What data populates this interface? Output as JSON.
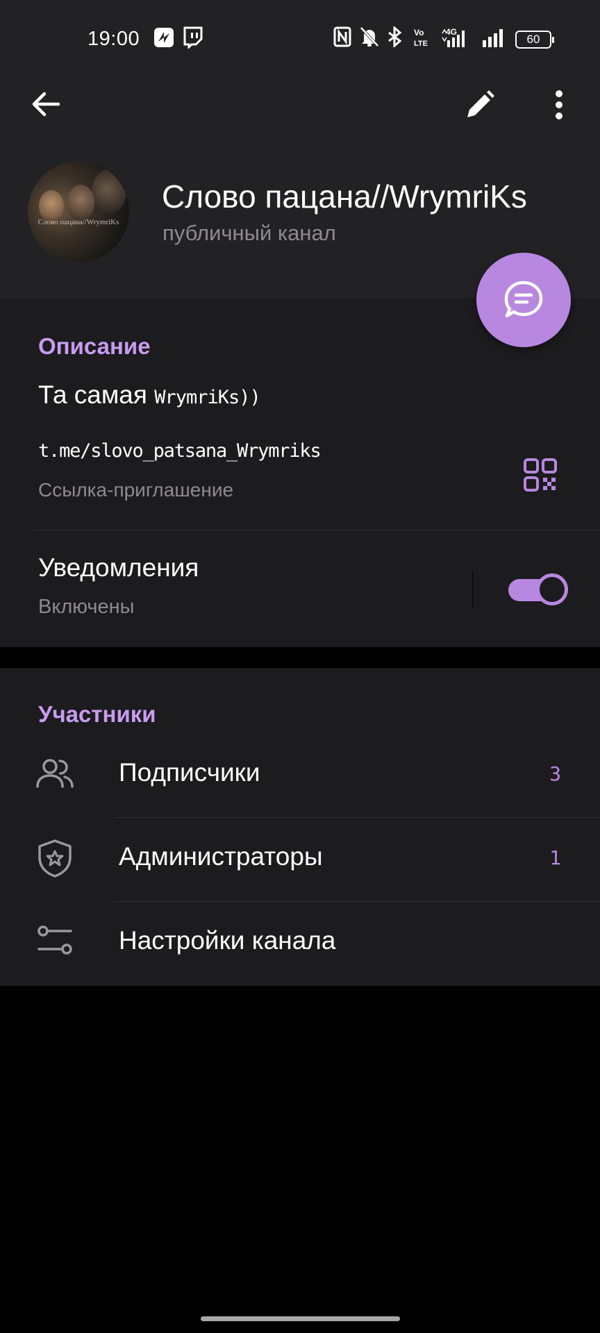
{
  "status_bar": {
    "time": "19:00",
    "battery": "60",
    "icons": [
      "flipboard-icon",
      "twitch-icon",
      "nfc-icon",
      "mute-icon",
      "bluetooth-icon",
      "volte-icon",
      "4g-icon",
      "signal-icon",
      "signal-icon-2",
      "battery-icon"
    ]
  },
  "toolbar": {
    "back_icon": "arrow-left-icon",
    "edit_icon": "pencil-icon",
    "more_icon": "more-vertical-icon"
  },
  "channel": {
    "title": "Слово пацана//WrymriKs",
    "subtitle": "публичный канал",
    "avatar_caption": "Слово пацана//WrymriKs"
  },
  "fab": {
    "icon": "chat-bubble-icon"
  },
  "description_section": {
    "title": "Описание",
    "text_prefix": "Та самая ",
    "text_handwritten": "WrymriKs))",
    "link": "t.me/slovo_patsana_Wrymriks",
    "link_caption": "Ссылка-приглашение",
    "qr_icon": "qr-code-icon"
  },
  "notifications": {
    "title": "Уведомления",
    "status": "Включены",
    "enabled": true
  },
  "members_section": {
    "title": "Участники",
    "rows": [
      {
        "label": "Подписчики",
        "count": "3",
        "icon": "users-icon"
      },
      {
        "label": "Администраторы",
        "count": "1",
        "icon": "shield-star-icon"
      },
      {
        "label": "Настройки канала",
        "count": "",
        "icon": "sliders-icon"
      }
    ]
  },
  "colors": {
    "accent": "#b887e0",
    "section_title": "#c89cf0",
    "surface": "#1c1b1e",
    "header": "#222124",
    "secondary_text": "#8d8b91"
  }
}
